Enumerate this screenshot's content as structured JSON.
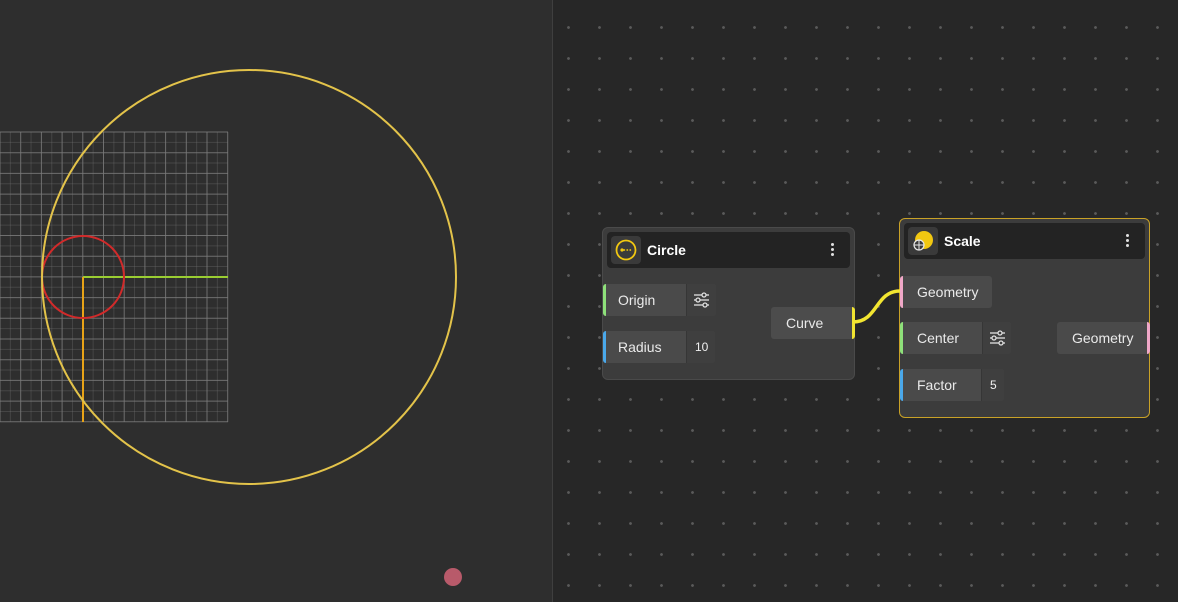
{
  "viewport": {
    "colors": {
      "grid": "#7a7a7a",
      "outer_circle": "#e3c34a",
      "inner_circle": "#d22a2a",
      "x_axis": "#9acd32",
      "y_axis": "#e8a317",
      "cursor": "#b85a6a"
    }
  },
  "nodes": {
    "circle": {
      "title": "Circle",
      "icon": "circle-curve-icon",
      "inputs": [
        {
          "label": "Origin",
          "value_icon": "sliders-icon",
          "color": "#8ee07a"
        },
        {
          "label": "Radius",
          "value": "10",
          "color": "#4aa8ea"
        }
      ],
      "output": {
        "label": "Curve",
        "color": "#f2e531"
      }
    },
    "scale": {
      "title": "Scale",
      "icon": "scale-icon",
      "inputs": [
        {
          "label": "Geometry",
          "color": "#f0a8c8"
        },
        {
          "label": "Center",
          "value_icon": "sliders-icon",
          "color": "#8ee07a"
        },
        {
          "label": "Factor",
          "value": "5",
          "color": "#4aa8ea"
        }
      ],
      "output": {
        "label": "Geometry",
        "color": "#f0a8c8"
      }
    }
  },
  "wire_color": "#f2e531"
}
